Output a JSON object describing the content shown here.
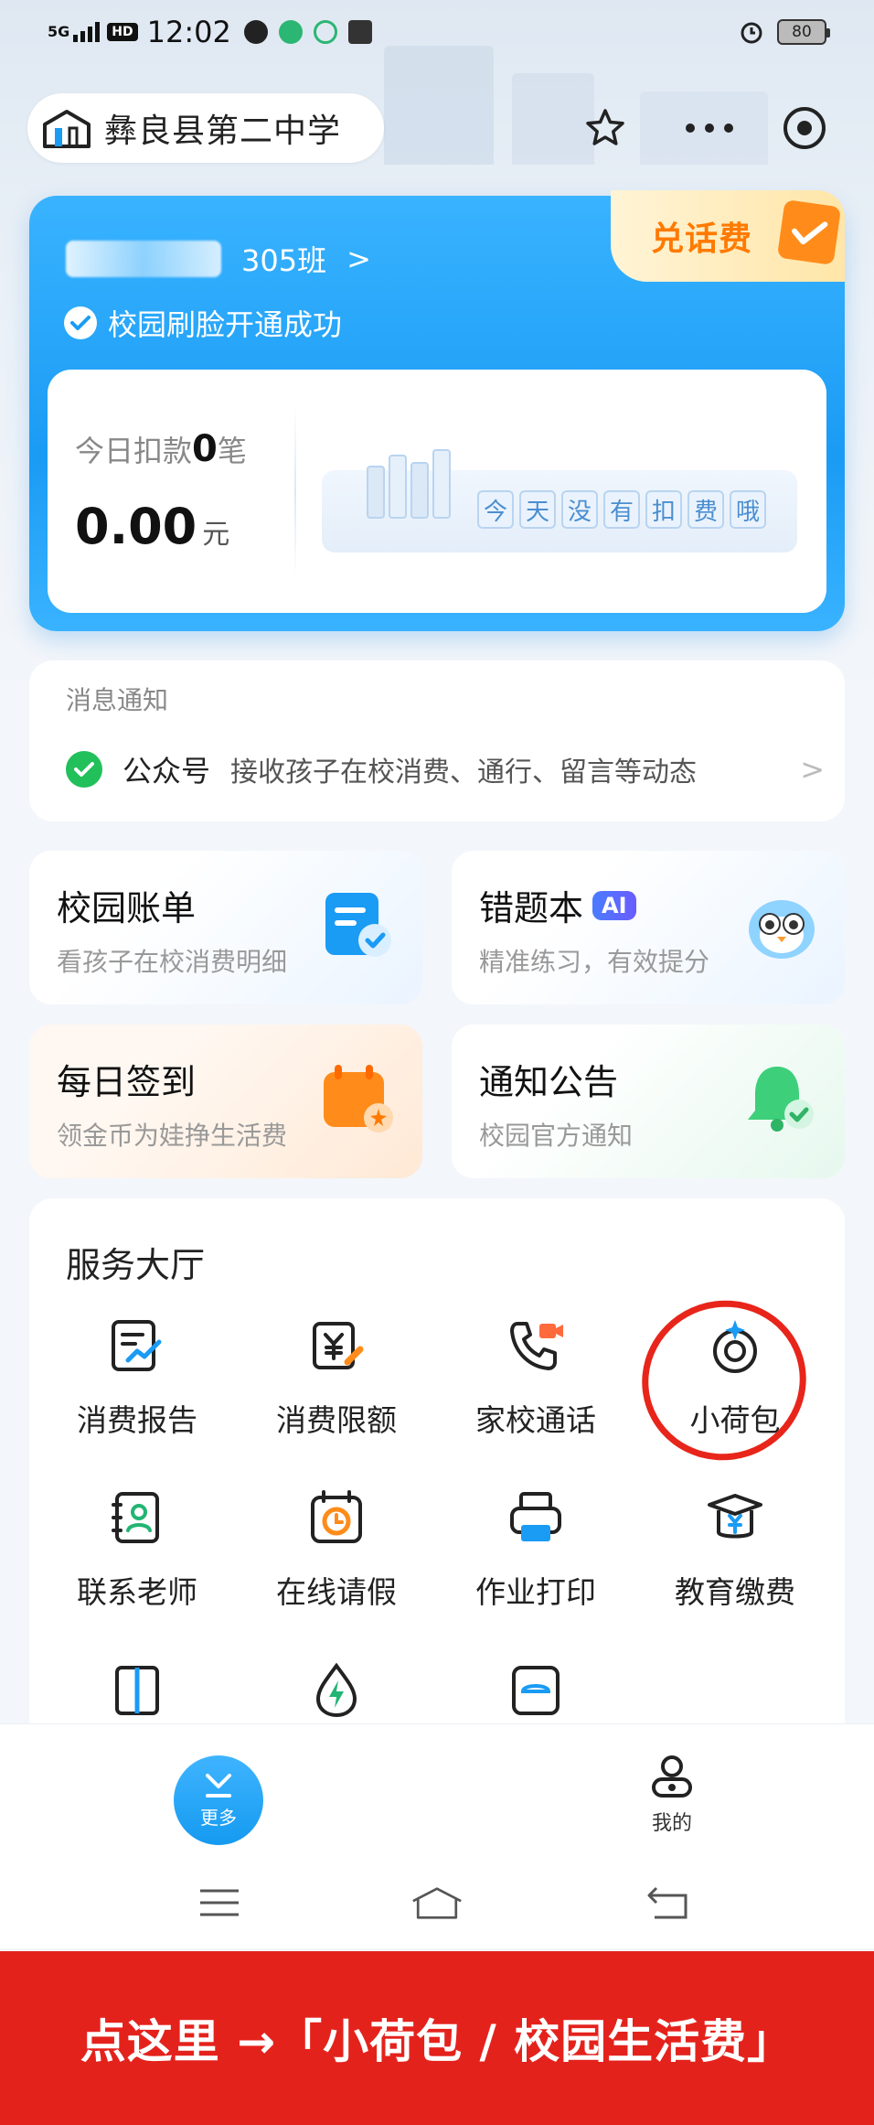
{
  "status_bar": {
    "network": "5G",
    "hd": "HD",
    "time": "12:02",
    "battery": "80"
  },
  "header": {
    "school_name": "彝良县第二中学"
  },
  "student_card": {
    "class_name": "305班",
    "face_status": "校园刷脸开通成功",
    "voucher_label": "兑话费",
    "today_label_prefix": "今日扣款",
    "today_count": "0",
    "today_label_suffix": "笔",
    "amount": "0.00",
    "amount_unit": "元",
    "no_fee_chars": [
      "今",
      "天",
      "没",
      "有",
      "扣",
      "费",
      "哦"
    ]
  },
  "messages": {
    "title": "消息通知",
    "item_label": "公众号",
    "item_desc": "接收孩子在校消费、通行、留言等动态"
  },
  "tiles": [
    {
      "title": "校园账单",
      "sub": "看孩子在校消费明细",
      "icon": "bill-icon"
    },
    {
      "title": "错题本",
      "badge": "AI",
      "sub": "精准练习，有效提分",
      "icon": "owl-mascot-icon"
    },
    {
      "title": "每日签到",
      "sub": "领金币为娃挣生活费",
      "icon": "sign-in-calendar-icon"
    },
    {
      "title": "通知公告",
      "sub": "校园官方通知",
      "icon": "bell-icon"
    }
  ],
  "service_hall": {
    "title": "服务大厅",
    "items": [
      {
        "label": "消费报告",
        "icon": "report-icon"
      },
      {
        "label": "消费限额",
        "icon": "limit-icon"
      },
      {
        "label": "家校通话",
        "icon": "phone-video-icon"
      },
      {
        "label": "小荷包",
        "icon": "wallet-icon"
      },
      {
        "label": "联系老师",
        "icon": "contact-teacher-icon"
      },
      {
        "label": "在线请假",
        "icon": "leave-clock-icon"
      },
      {
        "label": "作业打印",
        "icon": "printer-icon"
      },
      {
        "label": "教育缴费",
        "icon": "tuition-icon"
      }
    ]
  },
  "bottom_nav": {
    "more_label": "更多",
    "mine_label": "我的"
  },
  "banner": {
    "text": "点这里 →「小荷包 / 校园生活费」"
  },
  "colors": {
    "primary": "#1a9bf4",
    "accent": "#ff7a00",
    "annotation": "#e8251b",
    "banner": "#e4221c"
  }
}
